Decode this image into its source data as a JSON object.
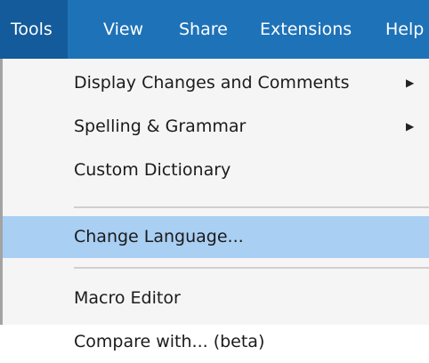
{
  "menubar": {
    "items": [
      {
        "label": "Tools",
        "active": true
      },
      {
        "label": "View",
        "active": false
      },
      {
        "label": "Share",
        "active": false
      },
      {
        "label": "Extensions",
        "active": false
      },
      {
        "label": "Help",
        "active": false
      }
    ]
  },
  "dropdown": {
    "items": [
      {
        "label": "Display Changes and Comments",
        "has_submenu": true,
        "submenu_icon": "triangle-right-icon"
      },
      {
        "label": "Spelling & Grammar",
        "has_submenu": true,
        "submenu_icon": "triangle-right-icon"
      },
      {
        "label": "Custom Dictionary",
        "has_submenu": false
      },
      {
        "label": "Change Language...",
        "has_submenu": false,
        "highlighted": true
      },
      {
        "label": "Macro Editor",
        "has_submenu": false
      },
      {
        "label": "Compare with... (beta)",
        "has_submenu": false
      }
    ]
  },
  "colors": {
    "menubar_bg": "#1e72b8",
    "menubar_active_bg": "#135b9a",
    "menubar_text": "#ffffff",
    "dropdown_bg": "#f5f5f5",
    "highlight_bg": "#a9cff3",
    "separator": "#cfcfcf",
    "item_text": "#1b1b1b"
  }
}
